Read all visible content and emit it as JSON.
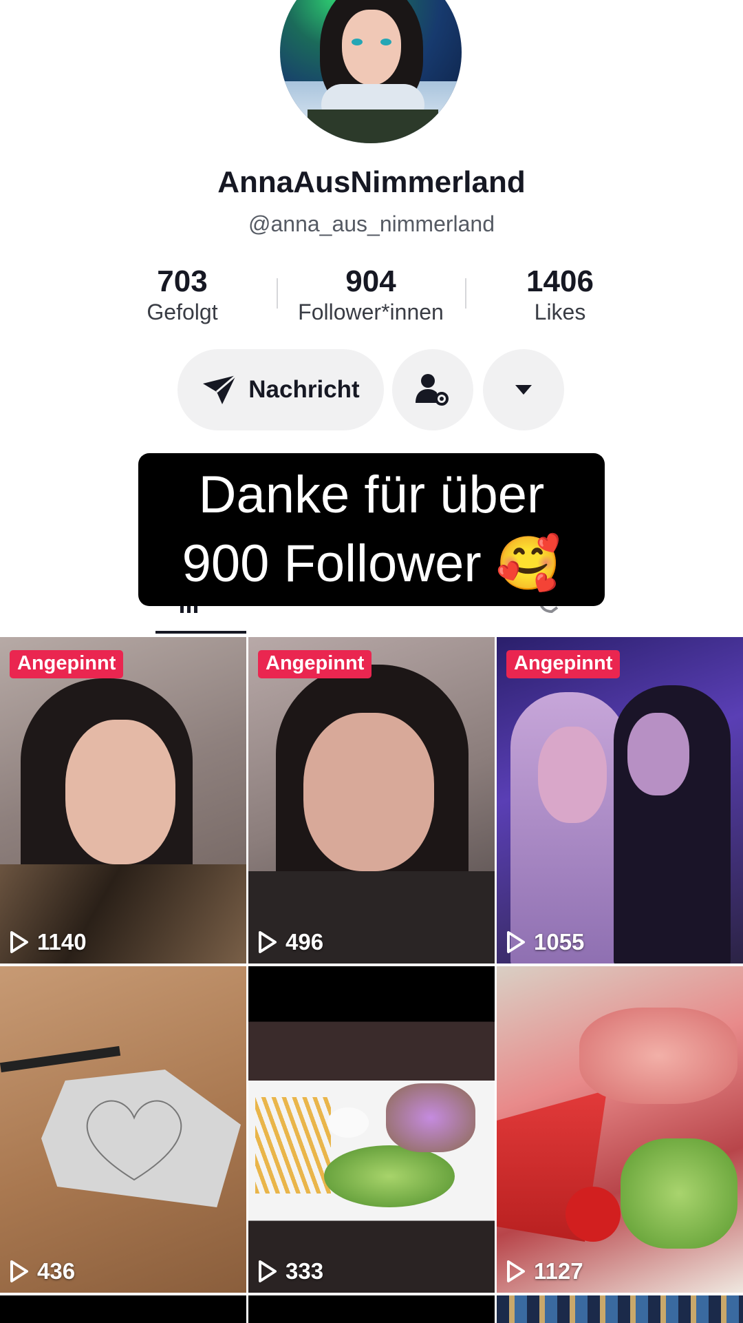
{
  "profile": {
    "display_name": "AnnaAusNimmerland",
    "handle": "@anna_aus_nimmerland"
  },
  "stats": [
    {
      "value": "703",
      "label": "Gefolgt"
    },
    {
      "value": "904",
      "label": "Follower*innen"
    },
    {
      "value": "1406",
      "label": "Likes"
    }
  ],
  "actions": {
    "message_label": "Nachricht",
    "message_icon": "send-icon",
    "user_settings_icon": "user-settings-icon",
    "more_icon": "caret-down-icon"
  },
  "overlay": {
    "line1": "Danke für über",
    "line2": "900 Follower 🥰"
  },
  "videos": [
    {
      "pinned_label": "Angepinnt",
      "views": "1140"
    },
    {
      "pinned_label": "Angepinnt",
      "views": "496"
    },
    {
      "pinned_label": "Angepinnt",
      "views": "1055"
    },
    {
      "views": "436"
    },
    {
      "views": "333"
    },
    {
      "views": "1127"
    }
  ],
  "colors": {
    "pinned_badge": "#ea2650",
    "button_bg": "#f1f1f2",
    "text_primary": "#161823"
  }
}
